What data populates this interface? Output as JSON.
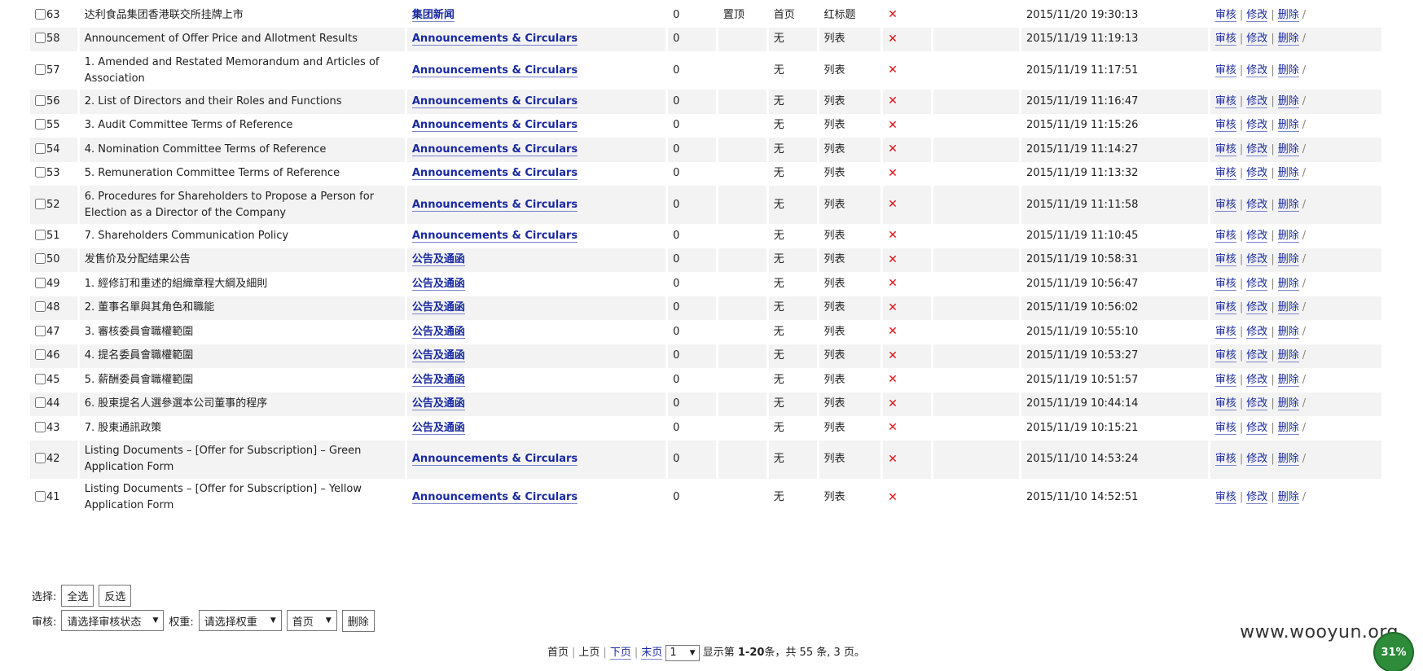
{
  "columns_note": "",
  "rows": [
    {
      "id": "63",
      "title": "达利食品集团香港联交所挂牌上市",
      "category": "集团新闻",
      "count": "0",
      "top": "置顶",
      "position": "首页",
      "style": "红标题",
      "created": "2015/11/20 19:30:13"
    },
    {
      "id": "58",
      "title": "Announcement of Offer Price and Allotment Results",
      "category": "Announcements & Circulars",
      "count": "0",
      "top": "",
      "position": "无",
      "style": "列表",
      "created": "2015/11/19 11:19:13"
    },
    {
      "id": "57",
      "title": "1. Amended and Restated Memorandum and Articles of Association",
      "category": "Announcements & Circulars",
      "count": "0",
      "top": "",
      "position": "无",
      "style": "列表",
      "created": "2015/11/19 11:17:51"
    },
    {
      "id": "56",
      "title": "2. List of Directors and their Roles and Functions",
      "category": "Announcements & Circulars",
      "count": "0",
      "top": "",
      "position": "无",
      "style": "列表",
      "created": "2015/11/19 11:16:47"
    },
    {
      "id": "55",
      "title": "3. Audit Committee Terms of Reference",
      "category": "Announcements & Circulars",
      "count": "0",
      "top": "",
      "position": "无",
      "style": "列表",
      "created": "2015/11/19 11:15:26"
    },
    {
      "id": "54",
      "title": "4. Nomination Committee Terms of Reference",
      "category": "Announcements & Circulars",
      "count": "0",
      "top": "",
      "position": "无",
      "style": "列表",
      "created": "2015/11/19 11:14:27"
    },
    {
      "id": "53",
      "title": "5. Remuneration Committee Terms of Reference",
      "category": "Announcements & Circulars",
      "count": "0",
      "top": "",
      "position": "无",
      "style": "列表",
      "created": "2015/11/19 11:13:32"
    },
    {
      "id": "52",
      "title": "6. Procedures for Shareholders to Propose a Person for Election as a Director of the Company",
      "category": "Announcements & Circulars",
      "count": "0",
      "top": "",
      "position": "无",
      "style": "列表",
      "created": "2015/11/19 11:11:58"
    },
    {
      "id": "51",
      "title": "7. Shareholders Communication Policy",
      "category": "Announcements & Circulars",
      "count": "0",
      "top": "",
      "position": "无",
      "style": "列表",
      "created": "2015/11/19 11:10:45"
    },
    {
      "id": "50",
      "title": "发售价及分配结果公告",
      "category": "公告及通函",
      "count": "0",
      "top": "",
      "position": "无",
      "style": "列表",
      "created": "2015/11/19 10:58:31"
    },
    {
      "id": "49",
      "title": "1. 經修訂和重述的組織章程大綱及細則",
      "category": "公告及通函",
      "count": "0",
      "top": "",
      "position": "无",
      "style": "列表",
      "created": "2015/11/19 10:56:47"
    },
    {
      "id": "48",
      "title": "2. 董事名單與其角色和職能",
      "category": "公告及通函",
      "count": "0",
      "top": "",
      "position": "无",
      "style": "列表",
      "created": "2015/11/19 10:56:02"
    },
    {
      "id": "47",
      "title": "3. 審核委員會職權範圍",
      "category": "公告及通函",
      "count": "0",
      "top": "",
      "position": "无",
      "style": "列表",
      "created": "2015/11/19 10:55:10"
    },
    {
      "id": "46",
      "title": "4. 提名委員會職權範圍",
      "category": "公告及通函",
      "count": "0",
      "top": "",
      "position": "无",
      "style": "列表",
      "created": "2015/11/19 10:53:27"
    },
    {
      "id": "45",
      "title": "5. 薪酬委員會職權範圍",
      "category": "公告及通函",
      "count": "0",
      "top": "",
      "position": "无",
      "style": "列表",
      "created": "2015/11/19 10:51:57"
    },
    {
      "id": "44",
      "title": "6. 股東提名人選參選本公司董事的程序",
      "category": "公告及通函",
      "count": "0",
      "top": "",
      "position": "无",
      "style": "列表",
      "created": "2015/11/19 10:44:14"
    },
    {
      "id": "43",
      "title": "7. 股東通訊政策",
      "category": "公告及通函",
      "count": "0",
      "top": "",
      "position": "无",
      "style": "列表",
      "created": "2015/11/19 10:15:21"
    },
    {
      "id": "42",
      "title": "Listing Documents – [Offer for Subscription] – Green Application Form",
      "category": "Announcements & Circulars",
      "count": "0",
      "top": "",
      "position": "无",
      "style": "列表",
      "created": "2015/11/10 14:53:24"
    },
    {
      "id": "41",
      "title": "Listing Documents – [Offer for Subscription] – Yellow Application Form",
      "category": "Announcements & Circulars",
      "count": "0",
      "top": "",
      "position": "无",
      "style": "列表",
      "created": "2015/11/10 14:52:51"
    }
  ],
  "row_status_icon": "red-x-icon",
  "actions": {
    "review": "审核",
    "edit": "修改",
    "delete": "删除",
    "separator": "|",
    "trailing": "/"
  },
  "controls": {
    "select_label": "选择:",
    "select_all": "全选",
    "invert": "反选",
    "review_label": "审核:",
    "review_select": "请选择审核状态",
    "weight_label": "权重:",
    "weight_select": "请选择权重",
    "position_select": "首页",
    "delete_button": "删除"
  },
  "pager": {
    "first": "首页",
    "prev": "上页",
    "next": "下页",
    "last": "末页",
    "page_value": "1",
    "summary_prefix": "显示第",
    "summary_range": "1-20",
    "summary_suffix": "条，共 55 条, 3 页。"
  },
  "watermark": "www.wooyun.org",
  "zoom_badge": "31%",
  "colors": {
    "link": "#1a2aa0",
    "x_mark": "#e01010",
    "row_alt": "#f3f3f3",
    "badge": "#2e8b3a"
  }
}
